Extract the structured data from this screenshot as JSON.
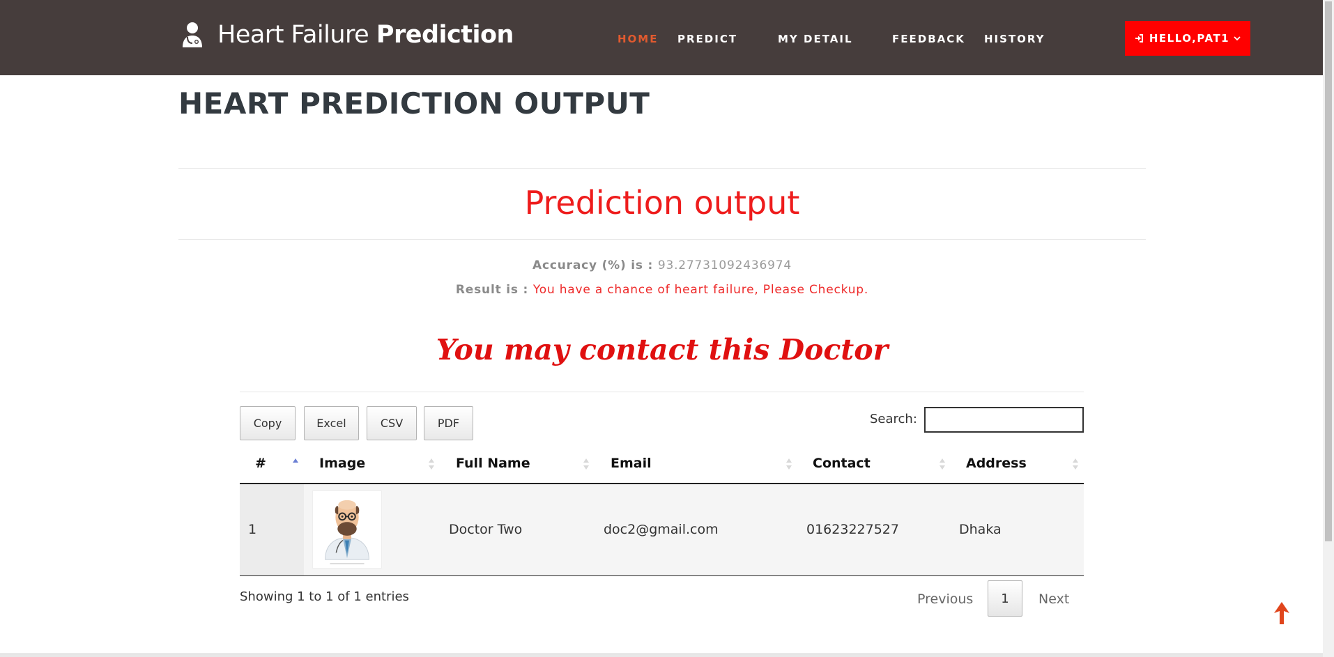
{
  "header": {
    "brand_light": "Heart Failure ",
    "brand_bold": "Prediction",
    "brand_icon": "doctor-icon",
    "nav": [
      {
        "label": "HOME",
        "active": true
      },
      {
        "label": "PREDICT",
        "active": false
      },
      {
        "label": "MY DETAIL",
        "active": false
      },
      {
        "label": "FEEDBACK",
        "active": false
      },
      {
        "label": "HISTORY",
        "active": false
      }
    ],
    "user_button": "HELLO,PAT1",
    "user_icon": "login-icon",
    "accent_color": "#ff0000",
    "bar_color": "#463d3c"
  },
  "page": {
    "heading": "HEART PREDICTION OUTPUT",
    "prediction_title": "Prediction output",
    "accuracy_label": "Accuracy (%) is : ",
    "accuracy_value": "93.27731092436974",
    "result_label": "Result is : ",
    "result_value": "You have a chance of heart failure, Please Checkup.",
    "contact_title": "You may contact this Doctor"
  },
  "table": {
    "buttons": [
      "Copy",
      "Excel",
      "CSV",
      "PDF"
    ],
    "search_label": "Search:",
    "search_value": "",
    "columns": [
      "#",
      "Image",
      "Full Name",
      "Email",
      "Contact",
      "Address"
    ],
    "rows": [
      {
        "index": "1",
        "image": "doctor-avatar",
        "full_name": "Doctor Two",
        "email": "doc2@gmail.com",
        "contact": "01623227527",
        "address": "Dhaka"
      }
    ],
    "showing": "Showing 1 to 1 of 1 entries",
    "pagination": {
      "previous": "Previous",
      "current": "1",
      "next": "Next"
    }
  }
}
